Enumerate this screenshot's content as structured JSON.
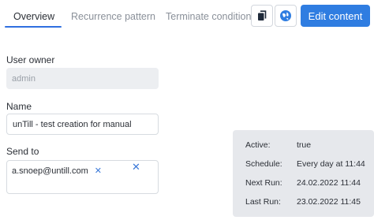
{
  "tabs": {
    "overview": "Overview",
    "recurrence": "Recurrence pattern",
    "terminate": "Terminate conditions"
  },
  "toolbar": {
    "copy_icon": "copy-icon",
    "globe_icon": "globe-icon",
    "edit_label": "Edit content"
  },
  "form": {
    "owner_label": "User owner",
    "owner_value": "admin",
    "name_label": "Name",
    "name_value": "unTill - test creation for manual",
    "send_label": "Send to",
    "send_tags": [
      "a.snoep@untill.com"
    ]
  },
  "info": {
    "active_label": "Active:",
    "active_value": "true",
    "schedule_label": "Schedule:",
    "schedule_value": "Every day at 11:44",
    "next_label": "Next Run:",
    "next_value": "24.02.2022 11:44",
    "last_label": "Last Run:",
    "last_value": "23.02.2022 11:45"
  },
  "colors": {
    "accent": "#2f7de1",
    "panel_bg": "#e6e8ec"
  }
}
